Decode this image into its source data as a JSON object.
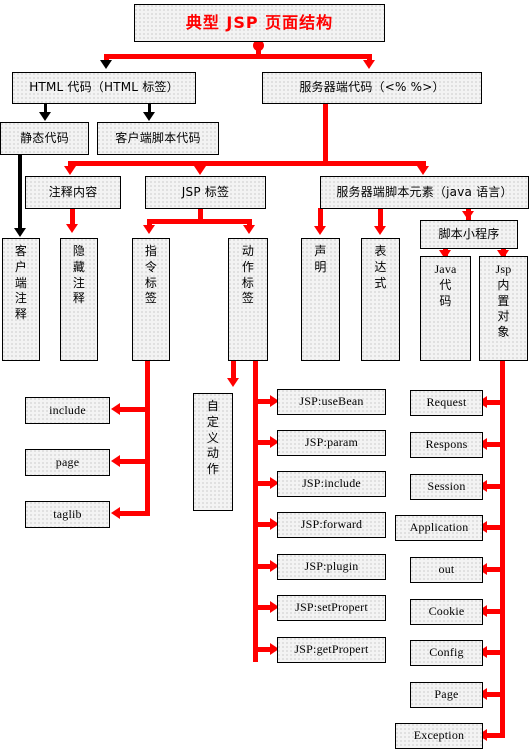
{
  "diagram": {
    "title": "典型 JSP 页面结构",
    "accent_color": "#ff0000",
    "node_fill": "#f3f3f3",
    "node_border": "#000000"
  },
  "nodes": {
    "root": "典型 JSP 页面结构",
    "html_code": "HTML 代码（HTML 标签）",
    "server_code": "服务器端代码（<%    %>）",
    "static_code": "静态代码",
    "client_script_code": "客户端脚本代码",
    "comment_content": "注释内容",
    "jsp_tag": "JSP 标签",
    "server_script_elements": "服务器端脚本元素（java 语言）",
    "client_comment": "客户端注释",
    "hidden_comment": "隐藏注释",
    "directive_tag": "指令标签",
    "action_tag": "动作标签",
    "declaration": "声明",
    "expression": "表达式",
    "scriptlet": "脚本小程序",
    "java_code": "Java 代码",
    "jsp_implicit_objects": "Jsp 内置对象",
    "custom_action": "自定义动作"
  },
  "directive_items": [
    {
      "label": "include"
    },
    {
      "label": "page"
    },
    {
      "label": "taglib"
    }
  ],
  "action_items": [
    {
      "label": "JSP:useBean"
    },
    {
      "label": "JSP:param"
    },
    {
      "label": "JSP:include"
    },
    {
      "label": "JSP:forward"
    },
    {
      "label": "JSP:plugin"
    },
    {
      "label": "JSP:setPropert"
    },
    {
      "label": "JSP:getPropert"
    }
  ],
  "implicit_objects": [
    {
      "label": "Request"
    },
    {
      "label": "Respons"
    },
    {
      "label": "Session"
    },
    {
      "label": "Application"
    },
    {
      "label": "out"
    },
    {
      "label": "Cookie"
    },
    {
      "label": "Config"
    },
    {
      "label": "Page"
    },
    {
      "label": "Exception"
    }
  ],
  "vertical_labels": {
    "client_comment": [
      "客",
      "户",
      "端",
      "注",
      "释"
    ],
    "hidden_comment": [
      "隐",
      "藏",
      "注",
      "释"
    ],
    "directive_tag": [
      "指",
      "令",
      "标",
      "签"
    ],
    "action_tag": [
      "动",
      "作",
      "标",
      "签"
    ],
    "declaration": [
      "声",
      "明"
    ],
    "expression": [
      "表",
      "达",
      "式"
    ],
    "java_code": [
      "Java",
      "代",
      "码"
    ],
    "jsp_implicit_objects": [
      "Jsp",
      "内",
      "置",
      "对",
      "象"
    ],
    "custom_action": [
      "自",
      "定",
      "义",
      "动",
      "作"
    ]
  }
}
